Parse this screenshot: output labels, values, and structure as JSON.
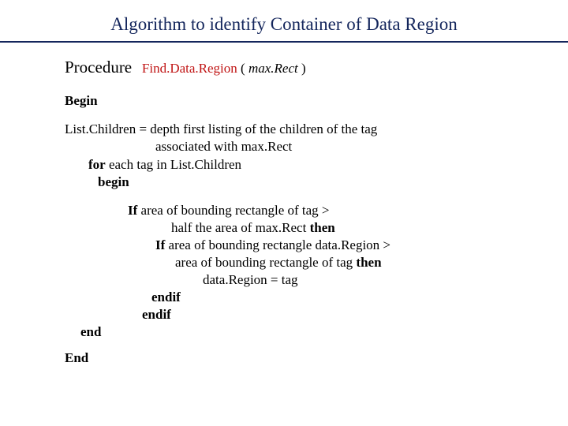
{
  "title": "Algorithm to identify Container of Data Region",
  "procedure": {
    "keyword": "Procedure",
    "name": "Find.Data.Region",
    "open": " ( ",
    "param": "max.Rect",
    "close": " )"
  },
  "begin": "Begin",
  "line1a": "List.Children  =  depth first listing of the children of the tag",
  "line1b": "associated with   max.Rect",
  "line2a": "for",
  "line2b": " each tag in List.Children",
  "line3": "begin",
  "if1a": "If",
  "if1b": " area of bounding rectangle of tag >",
  "if2a": "half the area of max.Rect ",
  "if2b": "then",
  "if3a": "If",
  "if3b": "  area of bounding rectangle data.Region >",
  "if4a": "area of bounding rectangle of tag   ",
  "if4b": "then",
  "if5": "data.Region = tag",
  "endif1": "endif",
  "endif2": "endif",
  "endloop": "end",
  "end": "End"
}
